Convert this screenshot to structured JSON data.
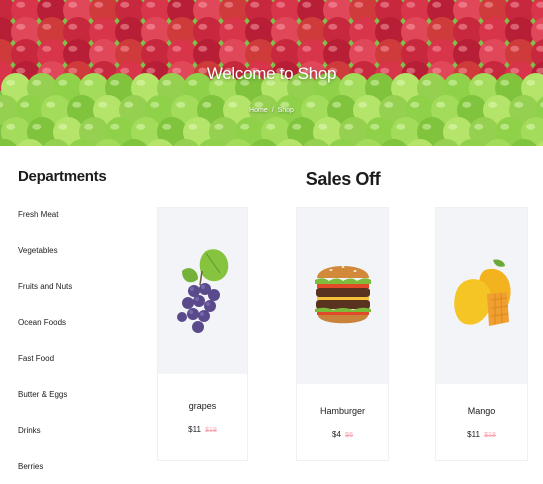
{
  "hero": {
    "title": "Welcome to Shop",
    "breadcrumb": [
      "Home",
      "Shop"
    ]
  },
  "departments": {
    "title": "Departments",
    "items": [
      "Fresh Meat",
      "Vegetables",
      "Fruits and Nuts",
      "Ocean Foods",
      "Fast Food",
      "Butter & Eggs",
      "Drinks",
      "Berries"
    ]
  },
  "sales": {
    "title": "Sales Off",
    "products": [
      {
        "name": "grapes",
        "price": "$11",
        "old_price": "$18",
        "icon": "grapes-icon"
      },
      {
        "name": "Hamburger",
        "price": "$4",
        "old_price": "$6",
        "icon": "hamburger-icon"
      },
      {
        "name": "Mango",
        "price": "$11",
        "old_price": "$18",
        "icon": "mango-icon"
      }
    ]
  },
  "colors": {
    "old_price": "#f7a4b0",
    "image_bg": "#f3f4f8"
  }
}
